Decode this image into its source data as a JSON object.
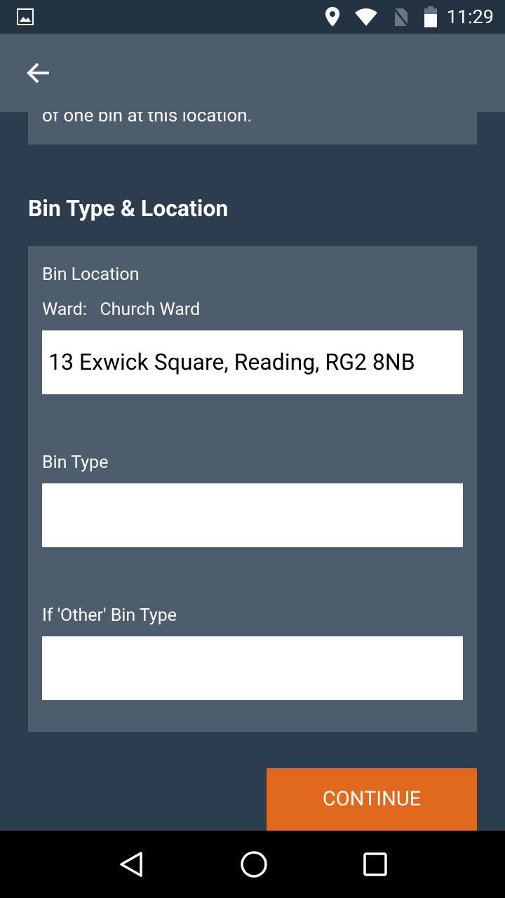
{
  "status_bar": {
    "time": "11:29",
    "icons": [
      "image-icon",
      "location-icon",
      "wifi-icon",
      "no-sim-icon",
      "battery-icon"
    ]
  },
  "toolbar": {
    "back_icon": "arrow-left-icon"
  },
  "intro_card": {
    "text": "of one bin at this location."
  },
  "section": {
    "title": "Bin Type & Location"
  },
  "form": {
    "bin_location_label": "Bin Location",
    "ward_label": "Ward:",
    "ward_value": "Church Ward",
    "address_value": "13 Exwick Square, Reading, RG2 8NB",
    "bin_type_label": "Bin Type",
    "bin_type_value": "",
    "other_bin_type_label": "If 'Other' Bin Type",
    "other_bin_type_value": ""
  },
  "continue_label": "CONTINUE",
  "colors": {
    "background": "#2c3d4f",
    "card": "#4d5d6d",
    "accent": "#e0691d"
  }
}
